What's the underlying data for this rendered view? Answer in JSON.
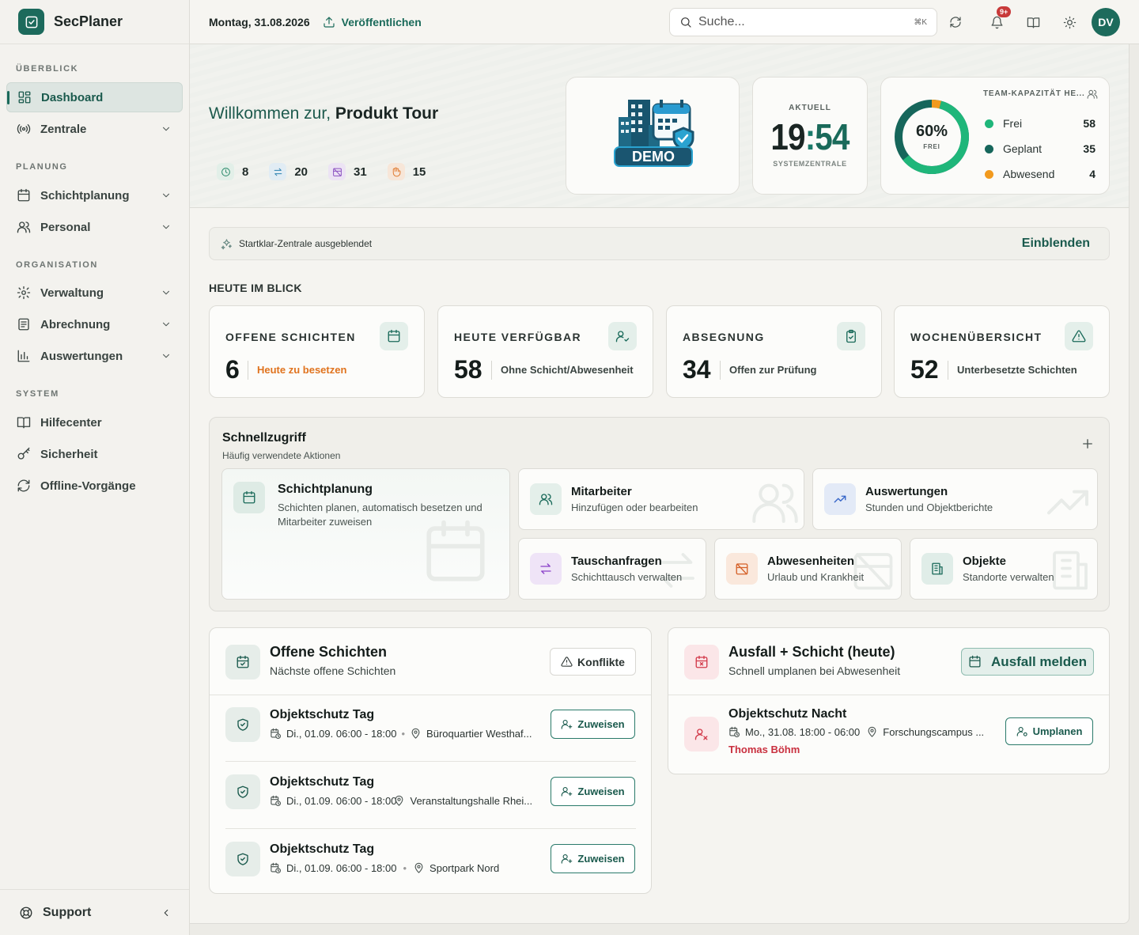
{
  "app": {
    "name": "SecPlaner"
  },
  "sidebar": {
    "sections": [
      {
        "label": "ÜBERBLICK"
      },
      {
        "label": "PLANUNG"
      },
      {
        "label": "ORGANISATION"
      },
      {
        "label": "SYSTEM"
      }
    ],
    "items": [
      {
        "label": "Dashboard",
        "icon": "dashboard-icon",
        "active": true
      },
      {
        "label": "Zentrale",
        "icon": "broadcast-icon",
        "expandable": true
      },
      {
        "label": "Schichtplanung",
        "icon": "calendar-icon",
        "expandable": true
      },
      {
        "label": "Personal",
        "icon": "users-icon",
        "expandable": true
      },
      {
        "label": "Verwaltung",
        "icon": "gear-icon",
        "expandable": true
      },
      {
        "label": "Abrechnung",
        "icon": "document-icon",
        "expandable": true
      },
      {
        "label": "Auswertungen",
        "icon": "bar-chart-icon",
        "expandable": true
      },
      {
        "label": "Hilfecenter",
        "icon": "book-icon"
      },
      {
        "label": "Sicherheit",
        "icon": "key-icon"
      },
      {
        "label": "Offline-Vorgänge",
        "icon": "sync-icon"
      }
    ],
    "support_label": "Support"
  },
  "topbar": {
    "date": "Montag, 31.08.2026",
    "publish_label": "Veröffentlichen",
    "search_placeholder": "Suche...",
    "search_shortcut": "⌘K",
    "notification_count": "9+",
    "avatar_initials": "DV"
  },
  "hero": {
    "welcome_prefix": "Willkommen zur,",
    "welcome_name": "Produkt Tour",
    "stats": [
      {
        "icon": "clock-icon",
        "value": "8",
        "color": "#2a8a6a"
      },
      {
        "icon": "swap-icon",
        "value": "20",
        "color": "#2a80b0"
      },
      {
        "icon": "calendar-off-icon",
        "value": "31",
        "color": "#8a50c0"
      },
      {
        "icon": "hand-icon",
        "value": "15",
        "color": "#e07a30"
      }
    ],
    "demo_label": "DEMO",
    "clock": {
      "label": "AKTUELL",
      "hours": "19",
      "minutes": "54",
      "sublabel": "SYSTEMZENTRALE"
    },
    "capacity": {
      "title": "TEAM-KAPAZITÄT HE...",
      "percent_label": "60%",
      "center_sub": "FREI",
      "free_fraction": 0.6,
      "items": [
        {
          "label": "Frei",
          "value": "58",
          "color": "#1fb67a"
        },
        {
          "label": "Geplant",
          "value": "35",
          "color": "#16665b"
        },
        {
          "label": "Abwesend",
          "value": "4",
          "color": "#f29a1e"
        }
      ]
    }
  },
  "startbar": {
    "text": "Startklar-Zentrale ausgeblendet",
    "button": "Einblenden"
  },
  "today": {
    "heading": "HEUTE IM BLICK",
    "kpis": [
      {
        "title": "OFFENE SCHICHTEN",
        "value": "6",
        "desc": "Heute zu besetzen",
        "icon": "calendar-icon",
        "desc_color": "#e0731e"
      },
      {
        "title": "HEUTE VERFÜGBAR",
        "value": "58",
        "desc": "Ohne Schicht/Abwesenheit",
        "icon": "user-check-icon",
        "desc_color": "#3a4441"
      },
      {
        "title": "ABSEGNUNG",
        "value": "34",
        "desc": "Offen zur Prüfung",
        "icon": "clipboard-check-icon",
        "desc_color": "#3a4441"
      },
      {
        "title": "WOCHENÜBERSICHT",
        "value": "52",
        "desc": "Unterbesetzte Schichten",
        "icon": "alert-triangle-icon",
        "desc_color": "#3a4441"
      }
    ]
  },
  "quick": {
    "title": "Schnellzugriff",
    "subtitle": "Häufig verwendete Aktionen",
    "actions": [
      {
        "title": "Schichtplanung",
        "desc": "Schichten planen, automatisch besetzen und Mitarbeiter zuweisen",
        "icon": "calendar-icon"
      },
      {
        "title": "Mitarbeiter",
        "desc": "Hinzufügen oder bearbeiten",
        "icon": "users-icon"
      },
      {
        "title": "Auswertungen",
        "desc": "Stunden und Objektberichte",
        "icon": "trend-up-icon"
      },
      {
        "title": "Tauschanfragen",
        "desc": "Schichttausch verwalten",
        "icon": "swap-icon"
      },
      {
        "title": "Abwesenheiten",
        "desc": "Urlaub und Krankheit",
        "icon": "calendar-off-icon"
      },
      {
        "title": "Objekte",
        "desc": "Standorte verwalten",
        "icon": "building-icon"
      }
    ]
  },
  "open_shifts": {
    "title": "Offene Schichten",
    "subtitle": "Nächste offene Schichten",
    "conflicts_label": "Konflikte",
    "assign_label": "Zuweisen",
    "items": [
      {
        "title": "Objektschutz Tag",
        "time": "Di., 01.09. 06:00 - 18:00",
        "location": "Büroquartier Westhaf..."
      },
      {
        "title": "Objektschutz Tag",
        "time": "Di., 01.09. 06:00 - 18:00",
        "location": "Veranstaltungshalle Rhei..."
      },
      {
        "title": "Objektschutz Tag",
        "time": "Di., 01.09. 06:00 - 18:00",
        "location": "Sportpark Nord"
      }
    ]
  },
  "absence": {
    "title": "Ausfall + Schicht (heute)",
    "subtitle": "Schnell umplanen bei Abwesenheit",
    "report_label": "Ausfall melden",
    "replan_label": "Umplanen",
    "items": [
      {
        "title": "Objektschutz Nacht",
        "time": "Mo., 31.08. 18:00 - 06:00",
        "location": "Forschungscampus ...",
        "person": "Thomas Böhm"
      }
    ]
  }
}
